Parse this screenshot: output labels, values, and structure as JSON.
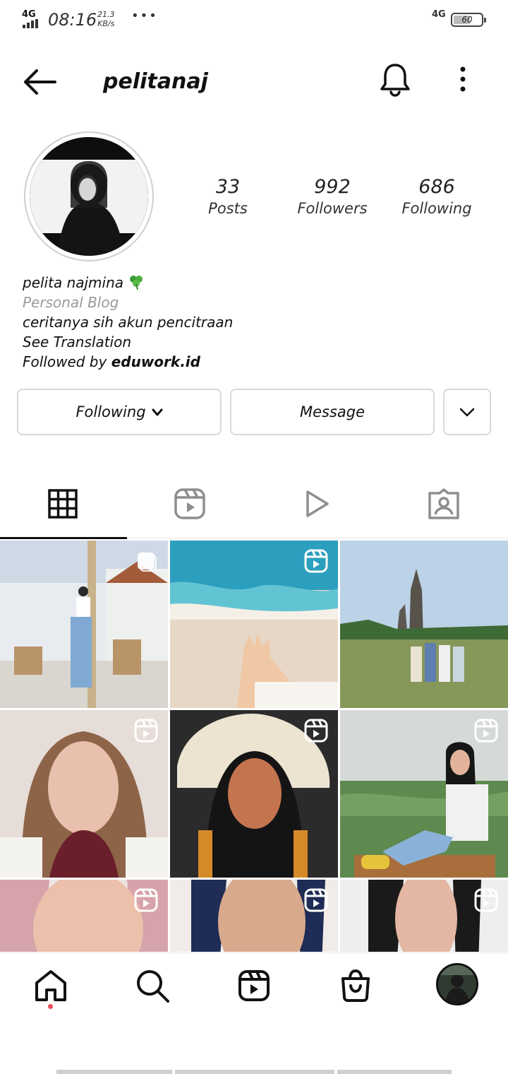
{
  "status_bar": {
    "network_left": "4G",
    "time": "08:16",
    "speed_value": "21.3",
    "speed_unit": "KB/s",
    "more": "•••",
    "network_right": "4G",
    "battery": "60",
    "battery_level": 0.6
  },
  "header": {
    "username": "pelitanaj",
    "back_icon": "arrow-left-icon",
    "bell_icon": "bell-icon",
    "more_icon": "vertical-dots-icon"
  },
  "profile": {
    "stats": [
      {
        "value": "33",
        "label": "Posts"
      },
      {
        "value": "992",
        "label": "Followers"
      },
      {
        "value": "686",
        "label": "Following"
      }
    ],
    "name": "pelita najmina",
    "category": "Personal Blog",
    "bio": "ceritanya sih akun pencitraan",
    "see_translation": "See Translation",
    "followed_by_prefix": "Followed by ",
    "followed_by_user": "eduwork.id"
  },
  "actions": {
    "following_label": "Following",
    "message_label": "Message"
  },
  "tabs": [
    {
      "icon": "grid-icon",
      "active": true
    },
    {
      "icon": "reels-icon",
      "active": false
    },
    {
      "icon": "play-icon",
      "active": false
    },
    {
      "icon": "tagged-icon",
      "active": false
    }
  ],
  "grid": {
    "posts": [
      {
        "kind": "carousel",
        "colors": [
          "#e9edf2",
          "#8fb3d9"
        ]
      },
      {
        "kind": "reel",
        "colors": [
          "#2aa7c5",
          "#e6d5c3"
        ]
      },
      {
        "kind": "photo",
        "colors": [
          "#b9cfe3",
          "#7b8f4a"
        ]
      },
      {
        "kind": "reel",
        "colors": [
          "#e3d8d4",
          "#8a5a3c"
        ]
      },
      {
        "kind": "reel",
        "colors": [
          "#e8d8bf",
          "#1c1c1c"
        ]
      },
      {
        "kind": "reel",
        "colors": [
          "#d5dad7",
          "#4c7a45"
        ]
      },
      {
        "kind": "reel",
        "colors": [
          "#e4c8c5",
          "#d69a8e"
        ]
      },
      {
        "kind": "reel",
        "colors": [
          "#f1ece9",
          "#1e2b52"
        ]
      },
      {
        "kind": "reel",
        "colors": [
          "#eeeeee",
          "#1a1a1a"
        ]
      }
    ]
  },
  "bottom_nav": [
    {
      "icon": "home-icon",
      "active": true
    },
    {
      "icon": "search-icon"
    },
    {
      "icon": "reels-icon"
    },
    {
      "icon": "shop-icon"
    },
    {
      "icon": "profile-avatar"
    }
  ],
  "colors": {
    "text": "#111111",
    "muted": "#9a9a9a",
    "border": "#d8d8d8",
    "notification_dot": "#ed4956"
  }
}
